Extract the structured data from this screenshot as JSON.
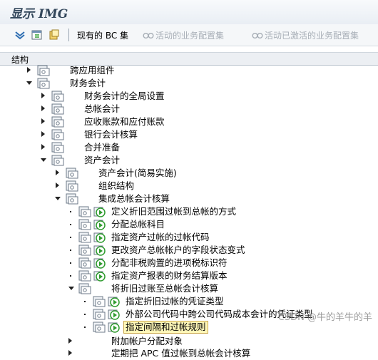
{
  "title": "显示 IMG",
  "toolbar": {
    "current_bc_set": "现有的 BC 集",
    "active_biz_config_set": "活动的业务配置集",
    "activated_biz_config_set": "活动已激活的业务配置集"
  },
  "header": {
    "label": "结构"
  },
  "tree": {
    "rows": [
      {
        "label": "跨应用组件"
      },
      {
        "label": "财务会计"
      },
      {
        "label": "财务会计的全局设置"
      },
      {
        "label": "总帐会计"
      },
      {
        "label": "应收账款和应付账款"
      },
      {
        "label": "银行会计核算"
      },
      {
        "label": "合并准备"
      },
      {
        "label": "资产会计"
      },
      {
        "label": "资产会计(简易实施)"
      },
      {
        "label": "组织结构"
      },
      {
        "label": "集成总帐会计核算"
      },
      {
        "label": "定义折旧范围过帐到总帐的方式"
      },
      {
        "label": "分配总帐科目"
      },
      {
        "label": "指定资产过帐的过帐代码"
      },
      {
        "label": "更改资产总帐帐户的字段状态变式"
      },
      {
        "label": "分配非税购置的进项税标识符"
      },
      {
        "label": "指定资产报表的财务结算版本"
      },
      {
        "label": "将折旧过账至总帐会计核算"
      },
      {
        "label": "指定折旧过帐的凭证类型"
      },
      {
        "label": "外部公司代码中跨公司代码成本会计的凭证类型"
      },
      {
        "label": "指定间隔和过帐规则"
      },
      {
        "label": "附加帐户分配对象"
      },
      {
        "label": "定期把 APC 值过帐到总帐会计核算"
      }
    ]
  },
  "watermark": "CSDN @牛的羊牛的羊",
  "colors": {
    "folder": "#d9dde3",
    "exec_arrow": "#2e9b2e",
    "highlight": "#fff7b8"
  }
}
